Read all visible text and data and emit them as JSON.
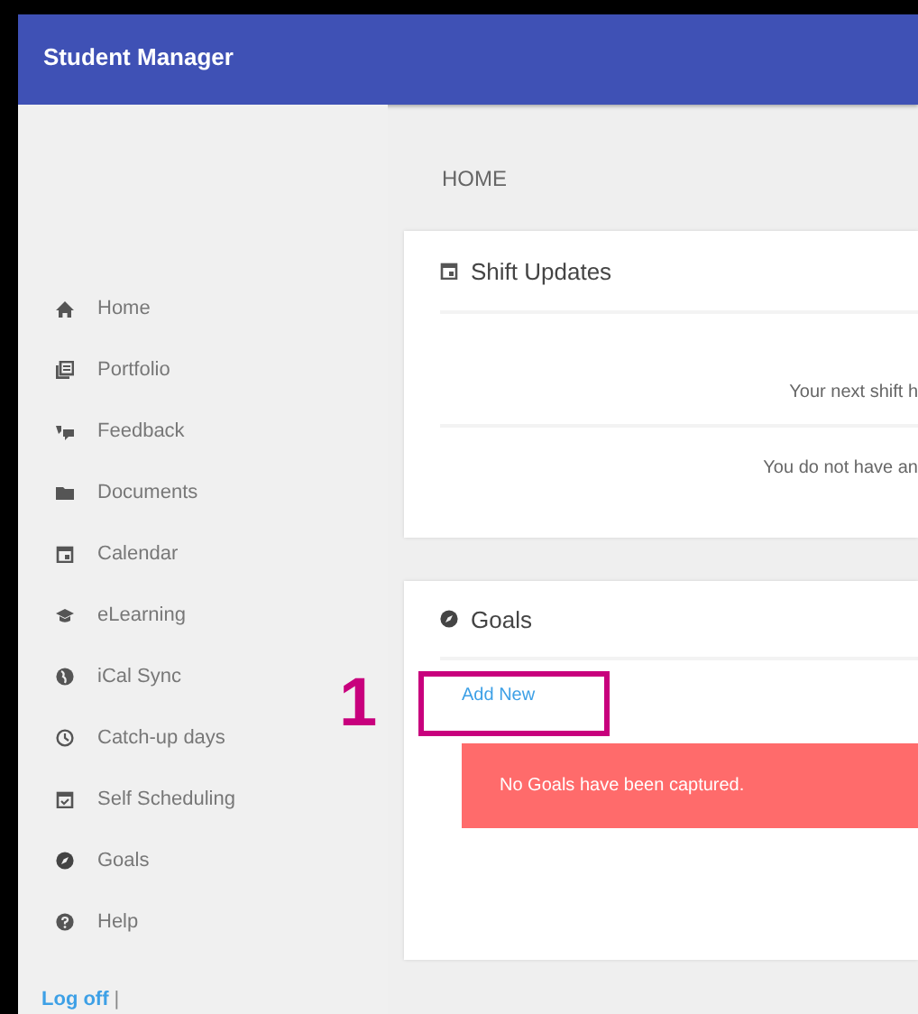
{
  "header": {
    "title": "Student Manager"
  },
  "sidebar": {
    "items": [
      {
        "label": "Home"
      },
      {
        "label": "Portfolio"
      },
      {
        "label": "Feedback"
      },
      {
        "label": "Documents"
      },
      {
        "label": "Calendar"
      },
      {
        "label": "eLearning"
      },
      {
        "label": "iCal Sync"
      },
      {
        "label": "Catch-up days"
      },
      {
        "label": "Self Scheduling"
      },
      {
        "label": "Goals"
      },
      {
        "label": "Help"
      }
    ],
    "logoff": "Log off",
    "separator": "|"
  },
  "breadcrumb": "HOME",
  "shift_updates": {
    "title": "Shift Updates",
    "messages": [
      "Your next shift h",
      "You do not have an"
    ]
  },
  "goals": {
    "title": "Goals",
    "add_link": "Add New",
    "alert": "No Goals have been captured."
  },
  "annotation": {
    "label": "1"
  }
}
